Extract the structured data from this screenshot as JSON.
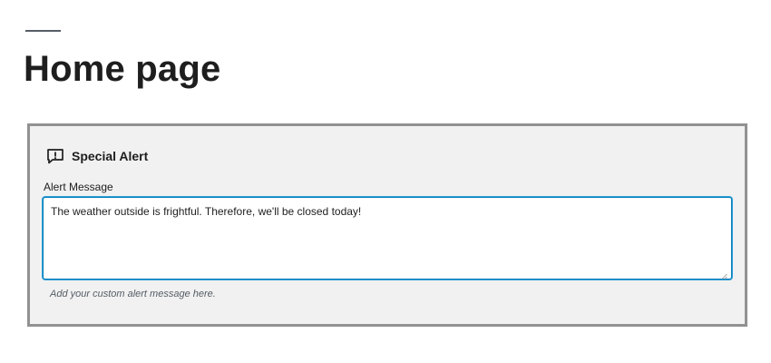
{
  "page": {
    "title": "Home page"
  },
  "block": {
    "icon": "alert-icon",
    "title": "Special Alert",
    "field": {
      "label": "Alert Message",
      "value": "The weather outside is frightful. Therefore, we'll be closed today!",
      "help": "Add your custom alert message here."
    }
  },
  "colors": {
    "focus_border": "#007cba",
    "block_border": "#919191",
    "block_background": "#f1f1f1",
    "text": "#1e1e1e",
    "help_text": "#555d66"
  }
}
